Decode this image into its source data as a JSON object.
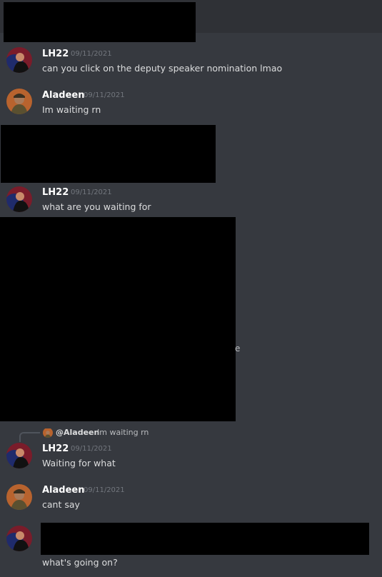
{
  "channel_header": {},
  "messages": [
    {
      "author": "LH22",
      "timestamp": "09/11/2021",
      "text": "can you click on the deputy speaker nomination lmao"
    },
    {
      "author": "Aladeen",
      "timestamp": "09/11/2021",
      "text": "Im waiting rn"
    },
    {
      "author": "LH22",
      "timestamp": "09/11/2021",
      "text": "what are you waiting for"
    },
    {
      "author": "LH22",
      "timestamp": "09/11/2021",
      "text": "Waiting for what"
    },
    {
      "author": "Aladeen",
      "timestamp": "09/11/2021",
      "text": "cant say"
    },
    {
      "author": "",
      "timestamp": "",
      "text": "what's going on?"
    }
  ],
  "reply": {
    "mention": "@Aladeen",
    "text": "Im waiting rn"
  },
  "stray_glyph": "e",
  "colors": {
    "background": "#36393f",
    "header": "#2f3136",
    "name": "#ffffff",
    "timestamp": "#72767d",
    "text": "#dcddde"
  }
}
